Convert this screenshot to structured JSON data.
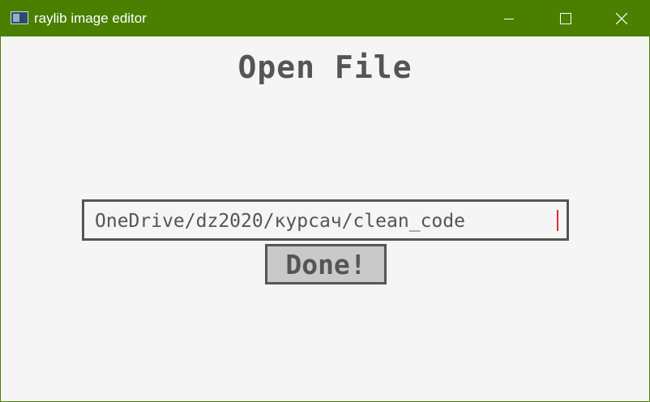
{
  "window": {
    "title": "raylib image editor",
    "app_icon": "raylib-app-icon",
    "controls": {
      "minimize_icon": "minimize-icon",
      "maximize_icon": "maximize-icon",
      "close_icon": "close-icon"
    },
    "titlebar_color": "#4a7f00"
  },
  "dialog": {
    "heading": "Open File",
    "path_input": {
      "value": "OneDrive/dz2020/курсач/clean_code",
      "focused": true
    },
    "done_button": {
      "label": "Done!"
    }
  },
  "colors": {
    "background": "#f5f5f5",
    "text": "#555555",
    "button_fill": "#c9c9c9",
    "caret": "#e62937"
  }
}
